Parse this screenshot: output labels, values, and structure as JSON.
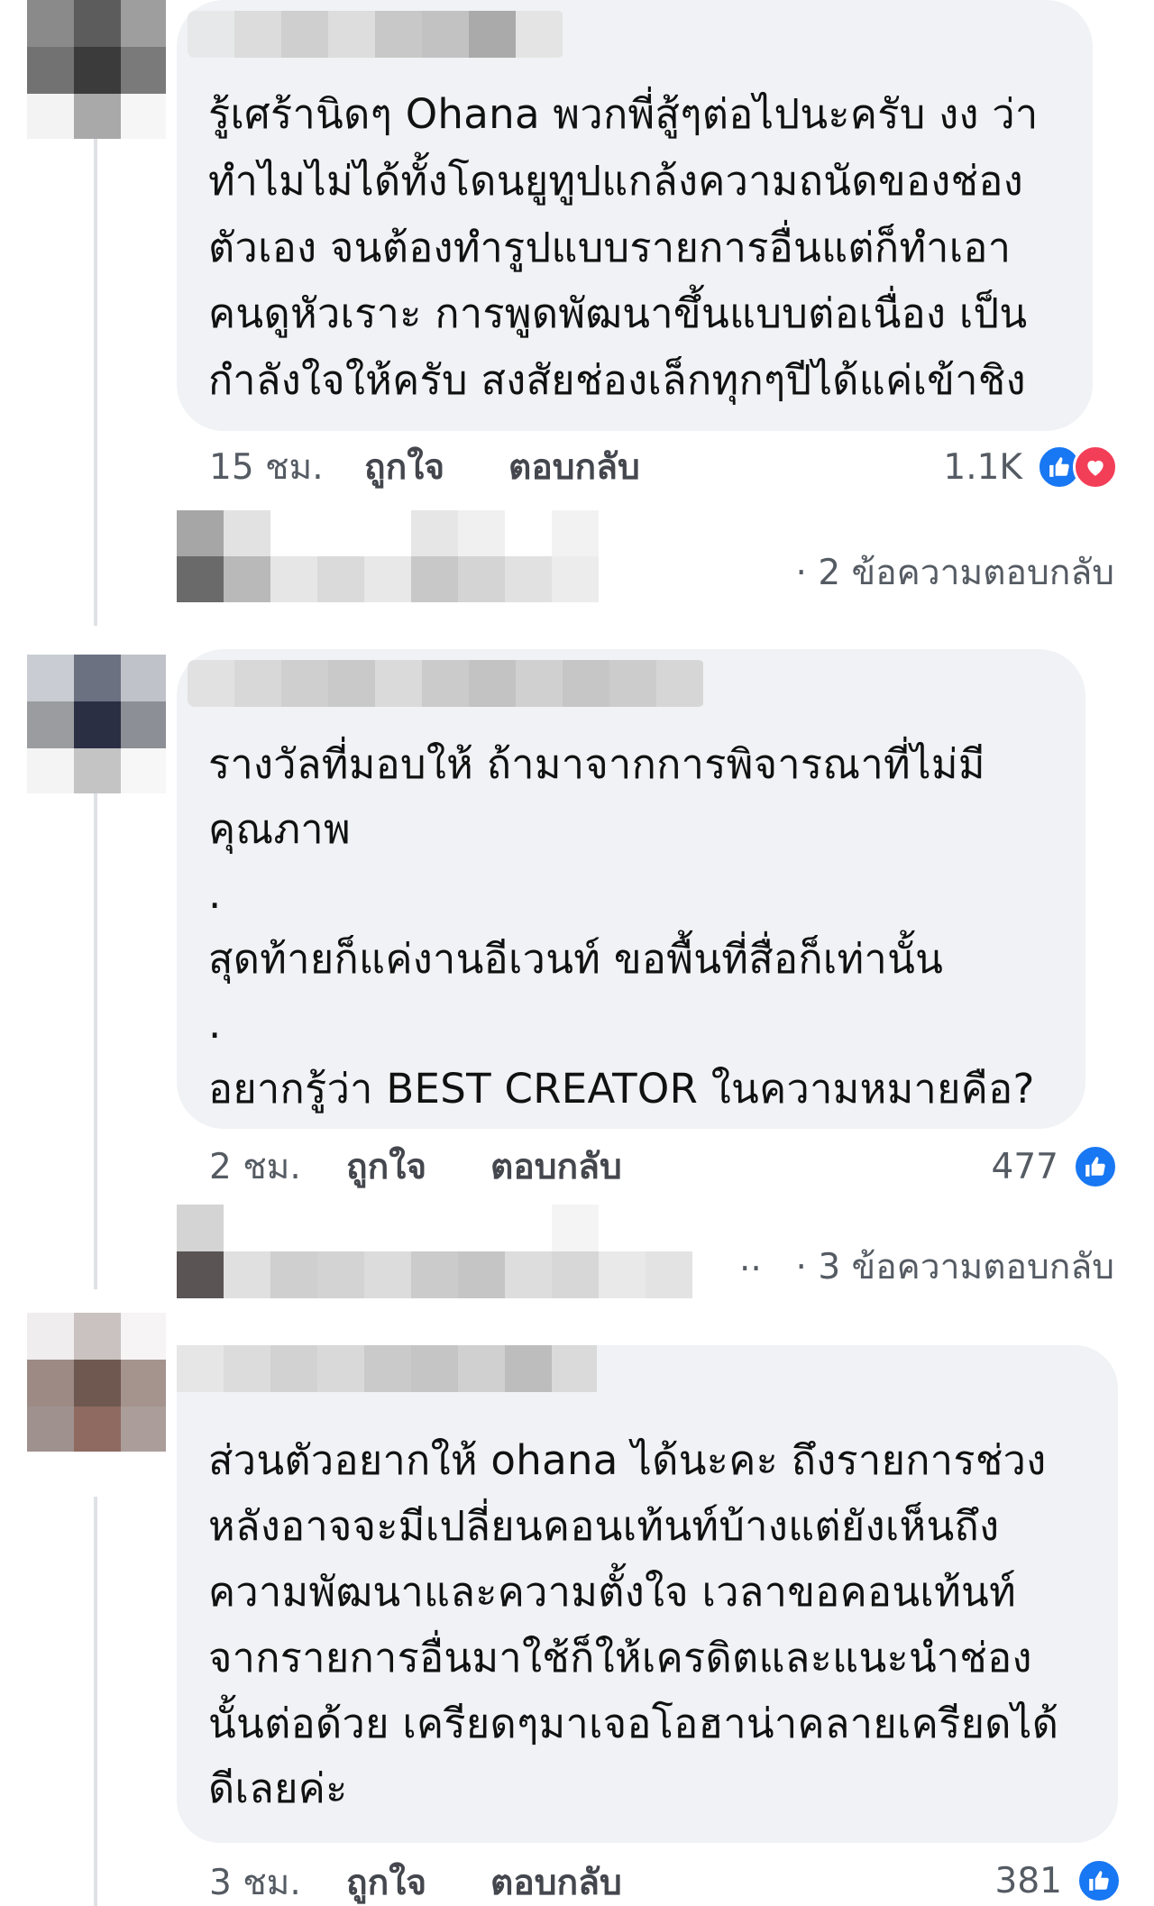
{
  "comments": [
    {
      "lines": [
        "รู้เศร้านิดๆ Ohana พวกพี่สู้ๆต่อไปนะครับ งง ว่า",
        "ทำไมไม่ได้ทั้งโดนยูทูปแกล้งความถนัดของช่อง",
        "ตัวเอง จนต้องทำรูปแบบรายการอื่นแต่ก็ทำเอา",
        "คนดูหัวเราะ การพูดพัฒนาขึ้นแบบต่อเนื่อง เป็น",
        "กำลังใจให้ครับ สงสัยช่องเล็กทุกๆปีได้แค่เข้าชิง"
      ],
      "time": "15 ชม.",
      "like_label": "ถูกใจ",
      "reply_label": "ตอบกลับ",
      "reaction_count": "1.1K",
      "reaction_icons": [
        "like-icon",
        "love-icon"
      ],
      "replies": "· 2 ข้อความตอบกลับ"
    },
    {
      "lines": [
        "รางวัลที่มอบให้ ถ้ามาจากการพิจารณาที่ไม่มี",
        "คุณภาพ",
        ".",
        "สุดท้ายก็แค่งานอีเวนท์ ขอพื้นที่สื่อก็เท่านั้น",
        ".",
        "อยากรู้ว่า BEST CREATOR ในความหมายคือ?"
      ],
      "time": "2 ชม.",
      "like_label": "ถูกใจ",
      "reply_label": "ตอบกลับ",
      "reaction_count": "477",
      "reaction_icons": [
        "like-icon"
      ],
      "replies_dots": "..",
      "replies": "· 3 ข้อความตอบกลับ"
    },
    {
      "lines": [
        "ส่วนตัวอยากให้ ohana ได้นะคะ ถึงรายการช่วง",
        "หลังอาจจะมีเปลี่ยนคอนเท้นท์บ้างแต่ยังเห็นถึง",
        "ความพัฒนาและความตั้งใจ เวลาขอคอนเท้นท์",
        "จากรายการอื่นมาใช้ก็ให้เครดิตและแนะนำช่อง",
        "นั้นต่อด้วย เครียดๆมาเจอโอฮาน่าคลายเครียดได้",
        "ดีเลยค่ะ"
      ],
      "time": "3 ชม.",
      "like_label": "ถูกใจ",
      "reply_label": "ตอบกลับ",
      "reaction_count": "381",
      "reaction_icons": [
        "like-icon"
      ]
    }
  ],
  "colors": {
    "bubble": "#f0f2f5",
    "like_blue": "#1877f2",
    "love_red": "#f33e58",
    "meta_text": "#555b63"
  }
}
